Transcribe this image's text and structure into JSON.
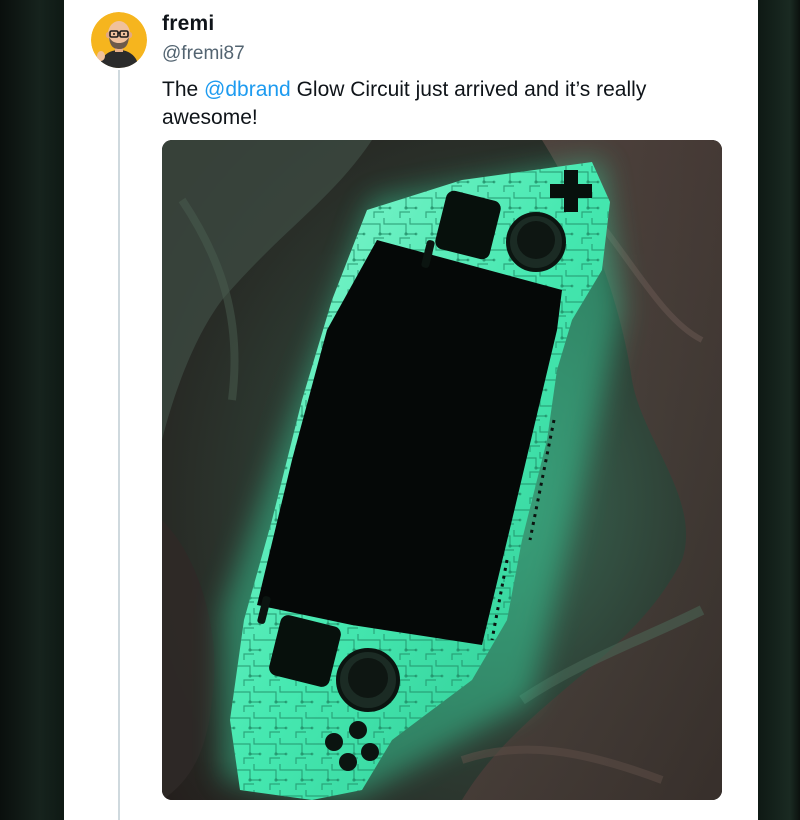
{
  "tweet": {
    "display_name": "fremi",
    "handle": "@fremi87",
    "text_before": "The ",
    "mention": "@dbrand",
    "text_after": " Glow Circuit just arrived and it’s really awesome!"
  },
  "media": {
    "subject": "glowing green circuit-pattern handheld console skin on fabric",
    "glow_color": "#3ff0b4"
  },
  "avatar": {
    "icon": "cartoon-bald-man-with-glasses-avatar",
    "background": "#f6b51e"
  },
  "colors": {
    "link": "#1d9bf0",
    "text": "#0f1419",
    "secondary": "#536471",
    "thread": "#cfd9de"
  }
}
